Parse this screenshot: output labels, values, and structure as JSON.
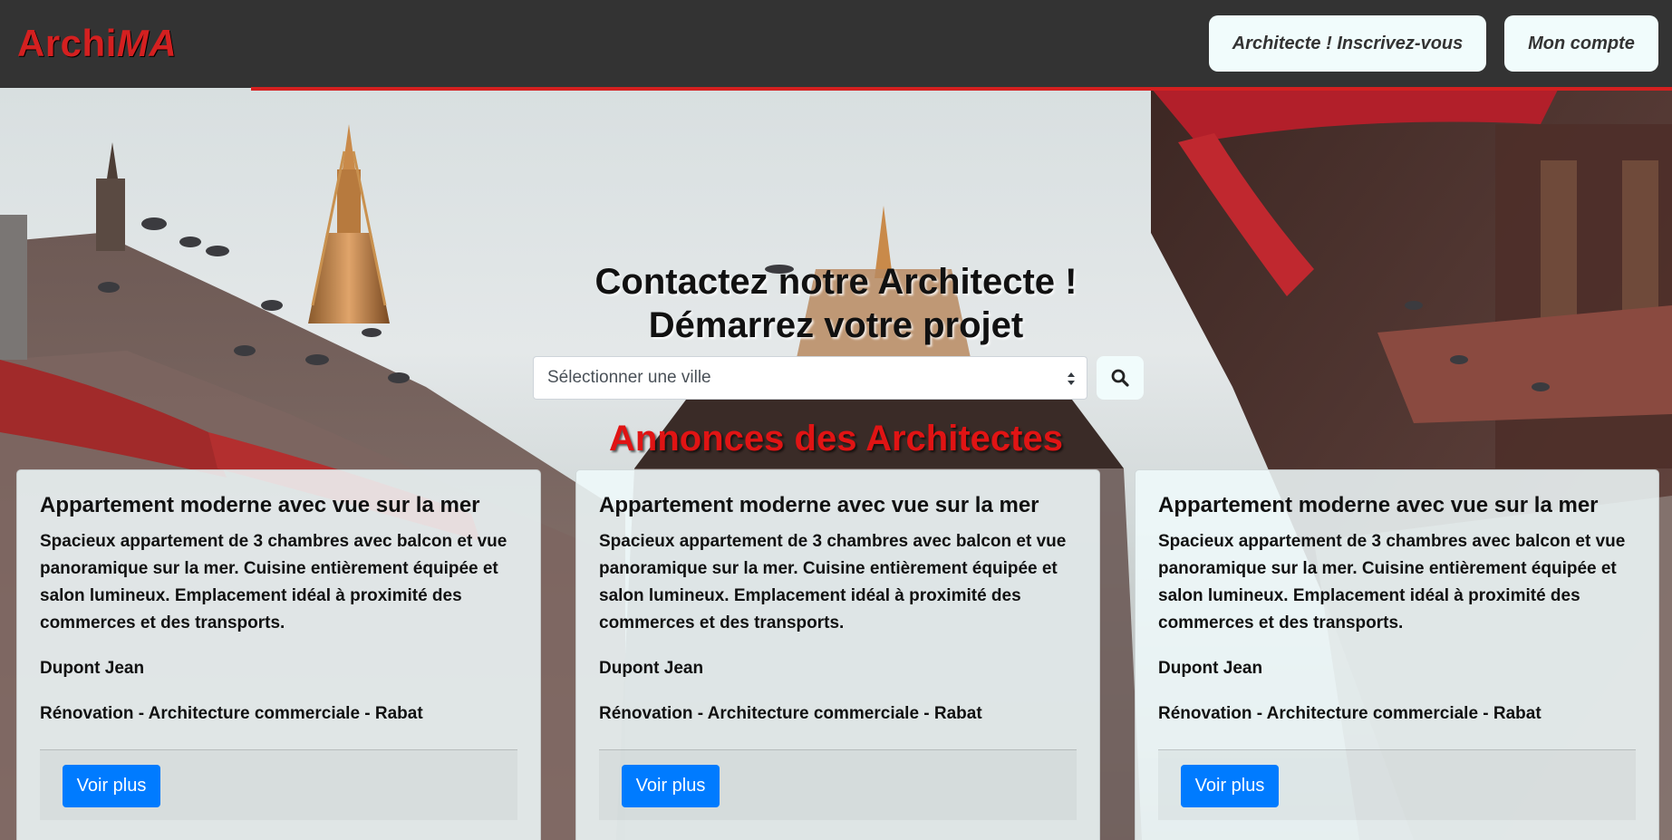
{
  "header": {
    "logo_prefix": "Archi",
    "logo_suffix": "MA",
    "register_label": "Architecte ! Inscrivez-vous",
    "account_label": "Mon compte"
  },
  "hero": {
    "title_line1": "Contactez notre Architecte !",
    "title_line2": "Démarrez votre projet",
    "city_select": {
      "selected": "Sélectionner une ville"
    },
    "search_icon": "search-icon",
    "section_title": "Annonces des Architectes"
  },
  "cards": [
    {
      "title": "Appartement moderne avec vue sur la mer",
      "description": "Spacieux appartement de 3 chambres avec balcon et vue panoramique sur la mer. Cuisine entièrement équipée et salon lumineux. Emplacement idéal à proximité des commerces et des transports.",
      "author": "Dupont Jean",
      "tags": "Rénovation - Architecture commerciale - Rabat",
      "button": "Voir plus"
    },
    {
      "title": "Appartement moderne avec vue sur la mer",
      "description": "Spacieux appartement de 3 chambres avec balcon et vue panoramique sur la mer. Cuisine entièrement équipée et salon lumineux. Emplacement idéal à proximité des commerces et des transports.",
      "author": "Dupont Jean",
      "tags": "Rénovation - Architecture commerciale - Rabat",
      "button": "Voir plus"
    },
    {
      "title": "Appartement moderne avec vue sur la mer",
      "description": "Spacieux appartement de 3 chambres avec balcon et vue panoramique sur la mer. Cuisine entièrement équipée et salon lumineux. Emplacement idéal à proximité des commerces et des transports.",
      "author": "Dupont Jean",
      "tags": "Rénovation - Architecture commerciale - Rabat",
      "button": "Voir plus"
    }
  ],
  "colors": {
    "brand_red": "#d42020",
    "navbar_bg": "#333333",
    "primary_button": "#007bff",
    "light_button": "#f1fcfc"
  }
}
